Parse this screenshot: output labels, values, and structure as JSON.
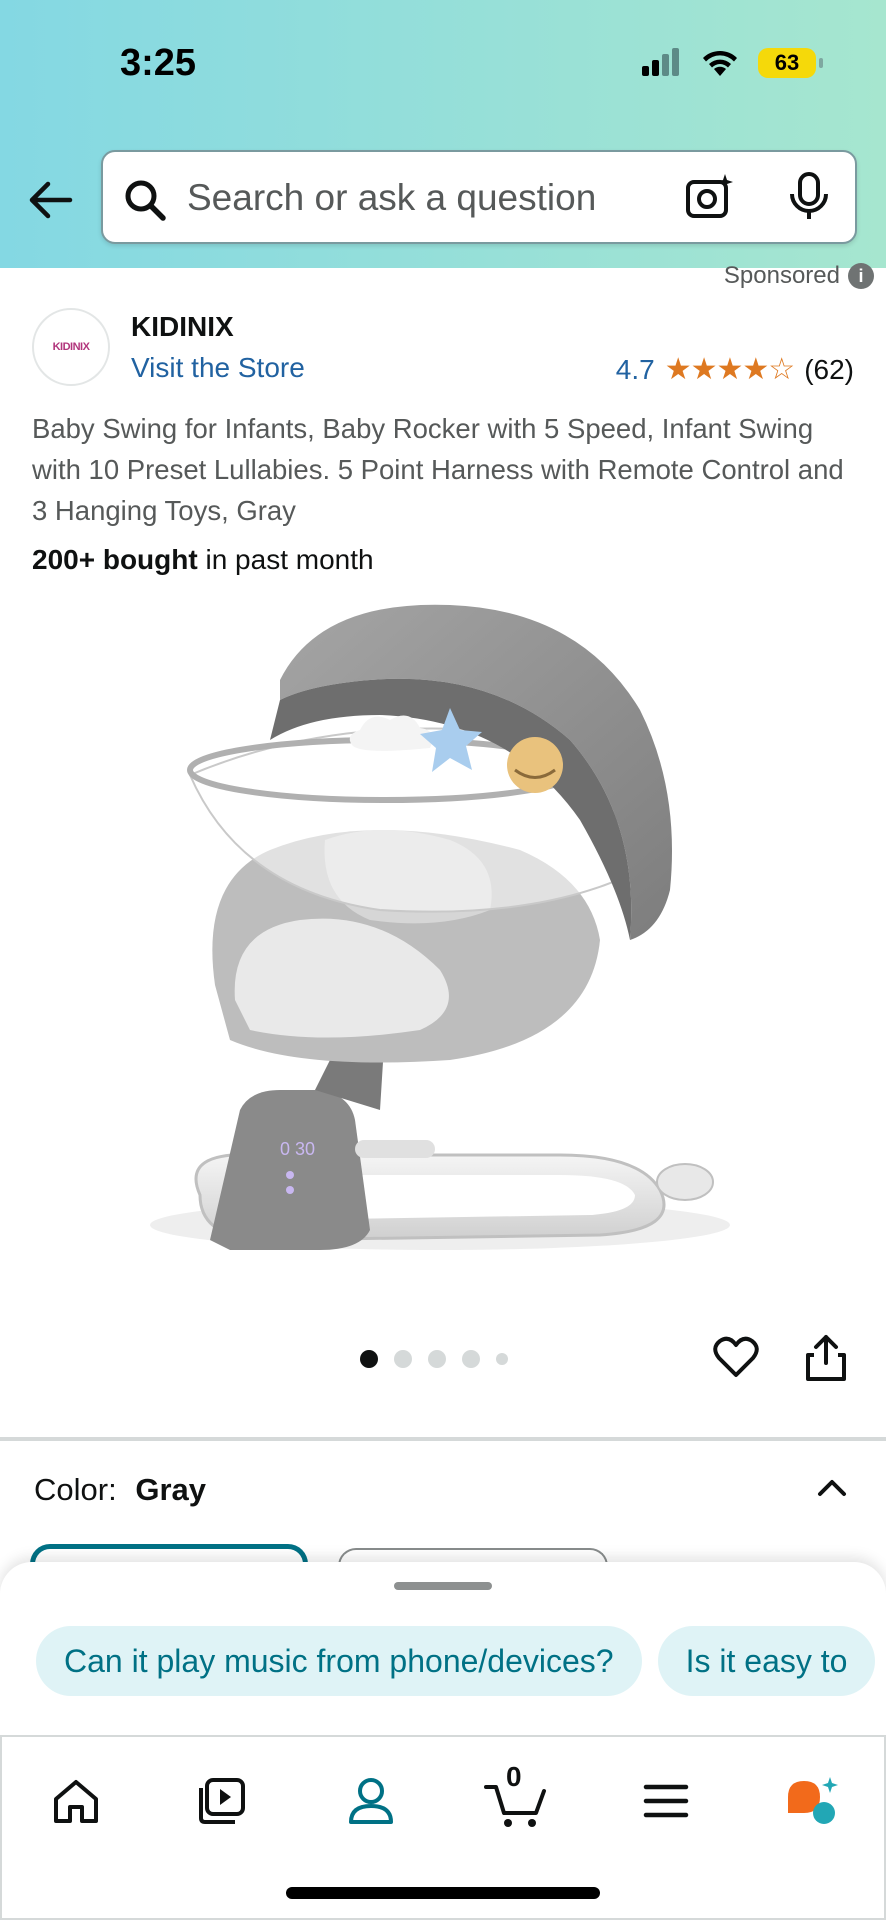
{
  "status_bar": {
    "time": "3:25",
    "battery": "63"
  },
  "search": {
    "placeholder": "Search or ask a question"
  },
  "sponsored": {
    "label": "Sponsored",
    "info": "i"
  },
  "brand": {
    "logo_text": "KIDINIX",
    "name": "KIDINIX",
    "store_link": "Visit the Store"
  },
  "rating": {
    "value": "4.7",
    "stars_glyphs": "★★★★☆",
    "stars": 4.7,
    "count": "(62)"
  },
  "product": {
    "title": "Baby Swing for Infants, Baby Rocker with 5 Speed, Infant Swing with 10 Preset Lullabies. 5 Point Harness with Remote Control and 3 Hanging Toys, Gray",
    "bought_bold": "200+ bought",
    "bought_rest": " in past month",
    "display_text": "0 30"
  },
  "carousel": {
    "total": 5,
    "active": 1
  },
  "color": {
    "label": "Color:",
    "value": "Gray"
  },
  "questions": [
    "Can it play music from phone/devices?",
    "Is it easy to"
  ],
  "cart": {
    "count": "0"
  },
  "colors": {
    "accent": "#007185",
    "link": "#2162a1",
    "star": "#de7921",
    "header_start": "#84d8e3",
    "header_end": "#a6e6cf"
  },
  "icons": [
    "back-arrow-icon",
    "search-icon",
    "camera-icon",
    "mic-icon",
    "heart-icon",
    "share-icon",
    "chevron-up-icon",
    "home-icon",
    "video-icon",
    "account-icon",
    "cart-icon",
    "menu-icon",
    "rufus-icon"
  ]
}
